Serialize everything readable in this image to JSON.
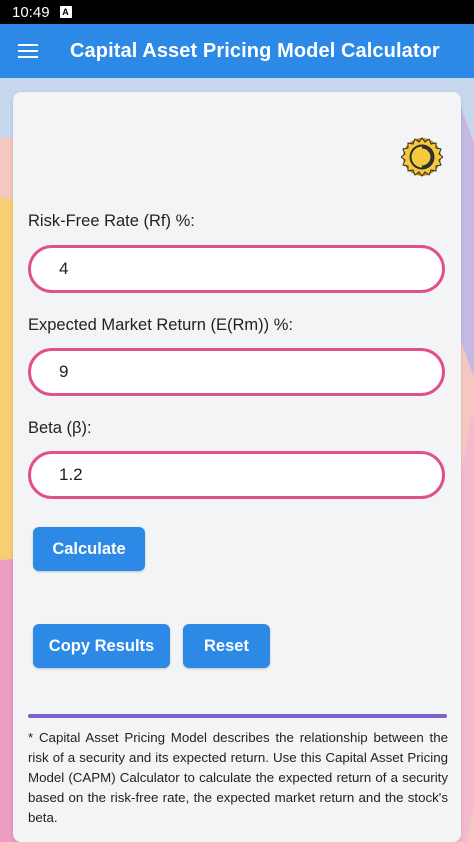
{
  "status_bar": {
    "time": "10:49",
    "notification_icon": "A"
  },
  "app_bar": {
    "title": "Capital Asset Pricing Model Calculator",
    "menu_icon": "hamburger-menu-icon"
  },
  "theme_toggle_icon": "half-circle-contrast-icon",
  "form": {
    "fields": [
      {
        "label": "Risk-Free Rate (Rf) %:",
        "value": "4"
      },
      {
        "label": "Expected Market Return (E(Rm)) %:",
        "value": "9"
      },
      {
        "label": "Beta (β):",
        "value": "1.2"
      }
    ],
    "calculate_label": "Calculate",
    "copy_label": "Copy Results",
    "reset_label": "Reset"
  },
  "note": "* Capital Asset Pricing Model describes the relationship between the risk of a security and its expected return. Use this Capital Asset Pricing Model (CAPM) Calculator to calculate the expected return of a security based on the risk-free rate, the expected market return and the stock's beta.",
  "colors": {
    "primary": "#2c8ae6",
    "input_border": "#e0518c",
    "divider": "#7d61c9",
    "toggle_fill": "#f5c93d"
  }
}
